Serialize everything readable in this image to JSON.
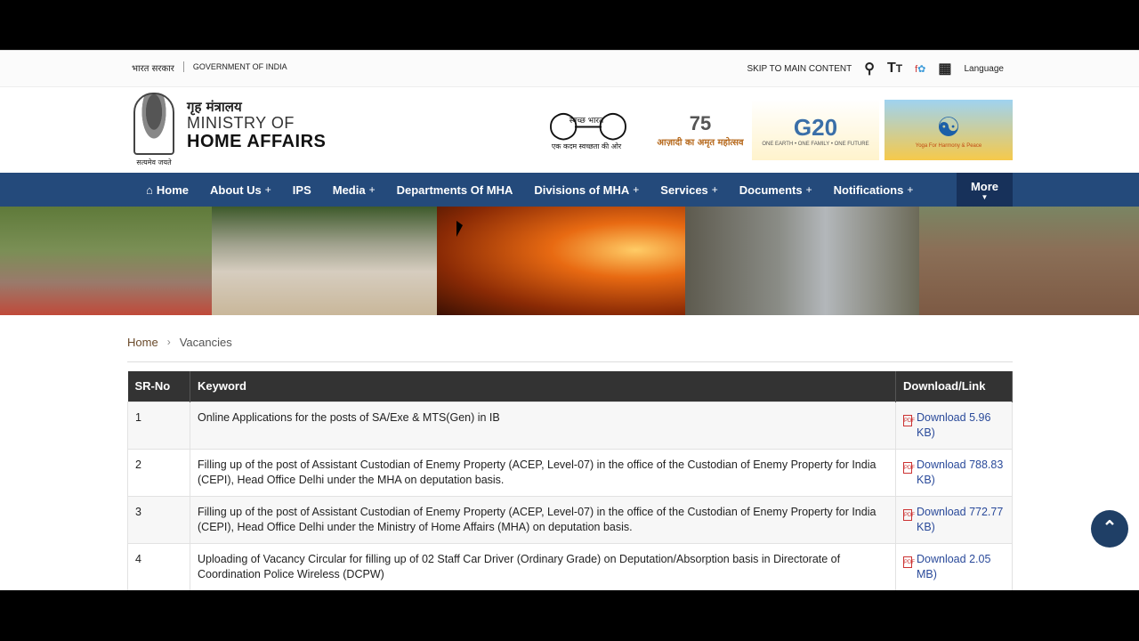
{
  "topbar": {
    "hindi_gov": "भारत सरकार",
    "gov_india": "GOVERNMENT OF INDIA",
    "skip": "SKIP TO MAIN CONTENT",
    "language": "Language"
  },
  "header": {
    "emblem_motto": "सत्यमेव जयते",
    "ministry_hindi": "गृह मंत्रालय",
    "ministry_line1": "MINISTRY OF",
    "ministry_line2": "HOME AFFAIRS",
    "swachh_caption": "एक कदम स्वच्छता की ओर",
    "swachh_text": "स्वच्छ भारत",
    "azadi_text": "आज़ादी का अमृत महोत्सव",
    "g20_text": "G20",
    "g20_caption": "ONE EARTH • ONE FAMILY • ONE FUTURE",
    "yoga_caption": "Yoga For Harmony & Peace"
  },
  "nav": {
    "items": [
      {
        "label": "Home",
        "plus": ""
      },
      {
        "label": "About Us",
        "plus": "+"
      },
      {
        "label": "IPS",
        "plus": ""
      },
      {
        "label": "Media",
        "plus": "+"
      },
      {
        "label": "Departments Of MHA",
        "plus": ""
      },
      {
        "label": "Divisions of MHA",
        "plus": "+"
      },
      {
        "label": "Services",
        "plus": "+"
      },
      {
        "label": "Documents",
        "plus": "+"
      },
      {
        "label": "Notifications",
        "plus": "+"
      }
    ],
    "more": "More"
  },
  "breadcrumb": {
    "home": "Home",
    "current": "Vacancies"
  },
  "table": {
    "headers": [
      "SR-No",
      "Keyword",
      "Download/Link"
    ],
    "rows": [
      {
        "sr": "1",
        "keyword": "Online Applications for the posts of SA/Exe & MTS(Gen) in IB",
        "link": "Download 5.96 KB)"
      },
      {
        "sr": "2",
        "keyword": "Filling up of the post of Assistant Custodian of Enemy Property (ACEP, Level-07) in the office of the Custodian of Enemy Property for India (CEPI), Head Office Delhi under the MHA on deputation basis.",
        "link": "Download 788.83 KB)"
      },
      {
        "sr": "3",
        "keyword": "Filling up of the post of Assistant Custodian of Enemy Property (ACEP, Level-07) in the office of the Custodian of Enemy Property for India (CEPI), Head Office Delhi under the Ministry of Home Affairs (MHA) on deputation basis.",
        "link": "Download 772.77 KB)"
      },
      {
        "sr": "4",
        "keyword": "Uploading of Vacancy Circular for filling up of 02 Staff Car Driver (Ordinary Grade) on Deputation/Absorption basis in Directorate of Coordination Police Wireless (DCPW)",
        "link": "Download 2.05 MB)"
      }
    ]
  },
  "icons": {
    "search": "search-icon",
    "text_size": "text-size-icon",
    "social": "social-icon",
    "sitemap": "sitemap-icon",
    "home": "home-icon",
    "pdf": "pdf-icon",
    "scroll_top": "chevron-up-icon"
  }
}
